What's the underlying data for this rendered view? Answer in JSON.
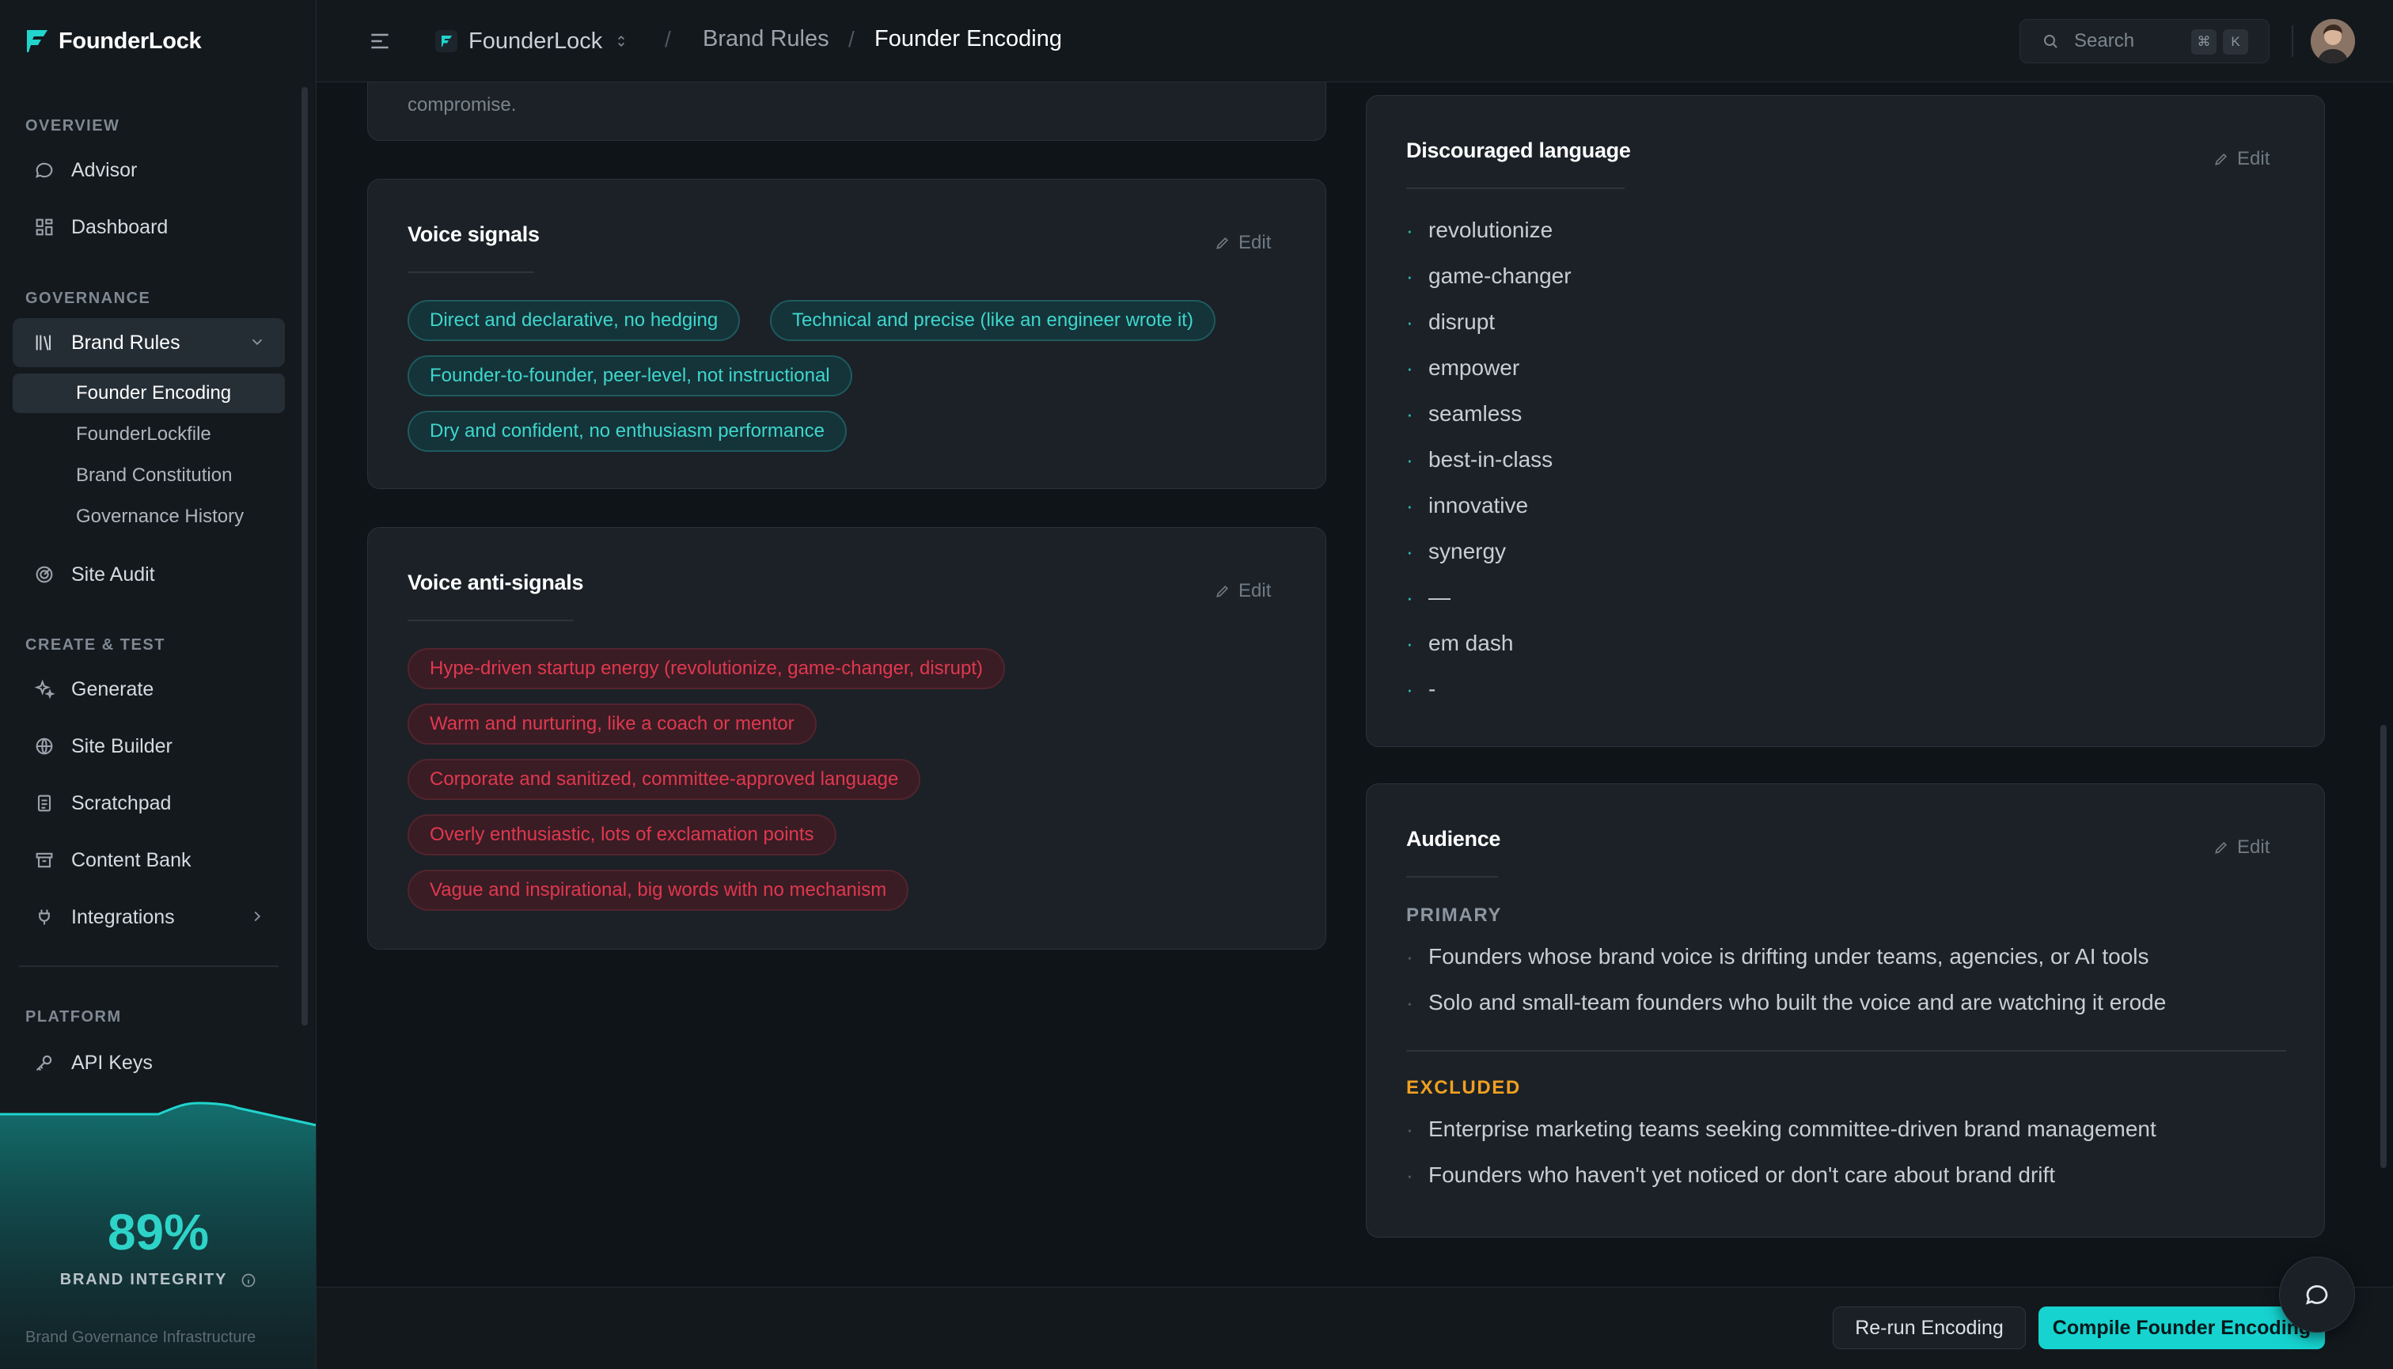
{
  "app": {
    "name": "FounderLock",
    "footer": "Brand Governance Infrastructure"
  },
  "colors": {
    "accent": "#16d3cf",
    "teal_text": "#3fd6cc",
    "danger_text": "#e0384f",
    "excluded": "#f0a020",
    "primary_label": "#8c96a0"
  },
  "sidebar": {
    "sections": [
      {
        "label": "OVERVIEW",
        "items": [
          {
            "label": "Advisor",
            "icon": "chat-bubble-icon"
          },
          {
            "label": "Dashboard",
            "icon": "grid-icon"
          }
        ]
      },
      {
        "label": "GOVERNANCE",
        "items": [
          {
            "label": "Brand Rules",
            "icon": "library-icon",
            "expanded": true,
            "children": [
              "Founder Encoding",
              "FounderLockfile",
              "Brand Constitution",
              "Governance History"
            ]
          },
          {
            "label": "Site Audit",
            "icon": "radar-icon"
          }
        ]
      },
      {
        "label": "CREATE & TEST",
        "items": [
          {
            "label": "Generate",
            "icon": "sparkles-icon"
          },
          {
            "label": "Site Builder",
            "icon": "globe-icon"
          },
          {
            "label": "Scratchpad",
            "icon": "notepad-icon"
          },
          {
            "label": "Content Bank",
            "icon": "archive-icon"
          },
          {
            "label": "Integrations",
            "icon": "plug-icon"
          }
        ]
      },
      {
        "label": "PLATFORM",
        "items": [
          {
            "label": "API Keys",
            "icon": "key-icon"
          }
        ]
      }
    ],
    "active_sub": "Founder Encoding",
    "integrity": {
      "value": "89%",
      "label": "BRAND INTEGRITY",
      "fraction": 0.89
    }
  },
  "header": {
    "workspace": "FounderLock",
    "breadcrumb": [
      "Brand Rules",
      "Founder Encoding"
    ],
    "search_placeholder": "Search",
    "shortcut": [
      "⌘",
      "K"
    ]
  },
  "main": {
    "partial_text": "compromise.",
    "voice_signals": {
      "title": "Voice signals",
      "edit": "Edit",
      "chips": [
        "Direct and declarative, no hedging",
        "Technical and precise (like an engineer wrote it)",
        "Founder-to-founder, peer-level, not instructional",
        "Dry and confident, no enthusiasm performance"
      ]
    },
    "voice_anti_signals": {
      "title": "Voice anti-signals",
      "edit": "Edit",
      "chips": [
        "Hype-driven startup energy (revolutionize, game-changer, disrupt)",
        "Warm and nurturing, like a coach or mentor",
        "Corporate and sanitized, committee-approved language",
        "Overly enthusiastic, lots of exclamation points",
        "Vague and inspirational, big words with no mechanism"
      ]
    },
    "discouraged": {
      "title": "Discouraged language",
      "edit": "Edit",
      "items": [
        "revolutionize",
        "game-changer",
        "disrupt",
        "empower",
        "seamless",
        "best-in-class",
        "innovative",
        "synergy",
        "—",
        "em dash",
        "-"
      ]
    },
    "audience": {
      "title": "Audience",
      "edit": "Edit",
      "primary_label": "PRIMARY",
      "primary": [
        "Founders whose brand voice is drifting under teams, agencies, or AI tools",
        "Solo and small-team founders who built the voice and are watching it erode"
      ],
      "excluded_label": "EXCLUDED",
      "excluded": [
        "Enterprise marketing teams seeking committee-driven brand management",
        "Founders who haven't yet noticed or don't care about brand drift"
      ]
    }
  },
  "actions": {
    "rerun": "Re-run Encoding",
    "compile": "Compile Founder Encoding"
  }
}
